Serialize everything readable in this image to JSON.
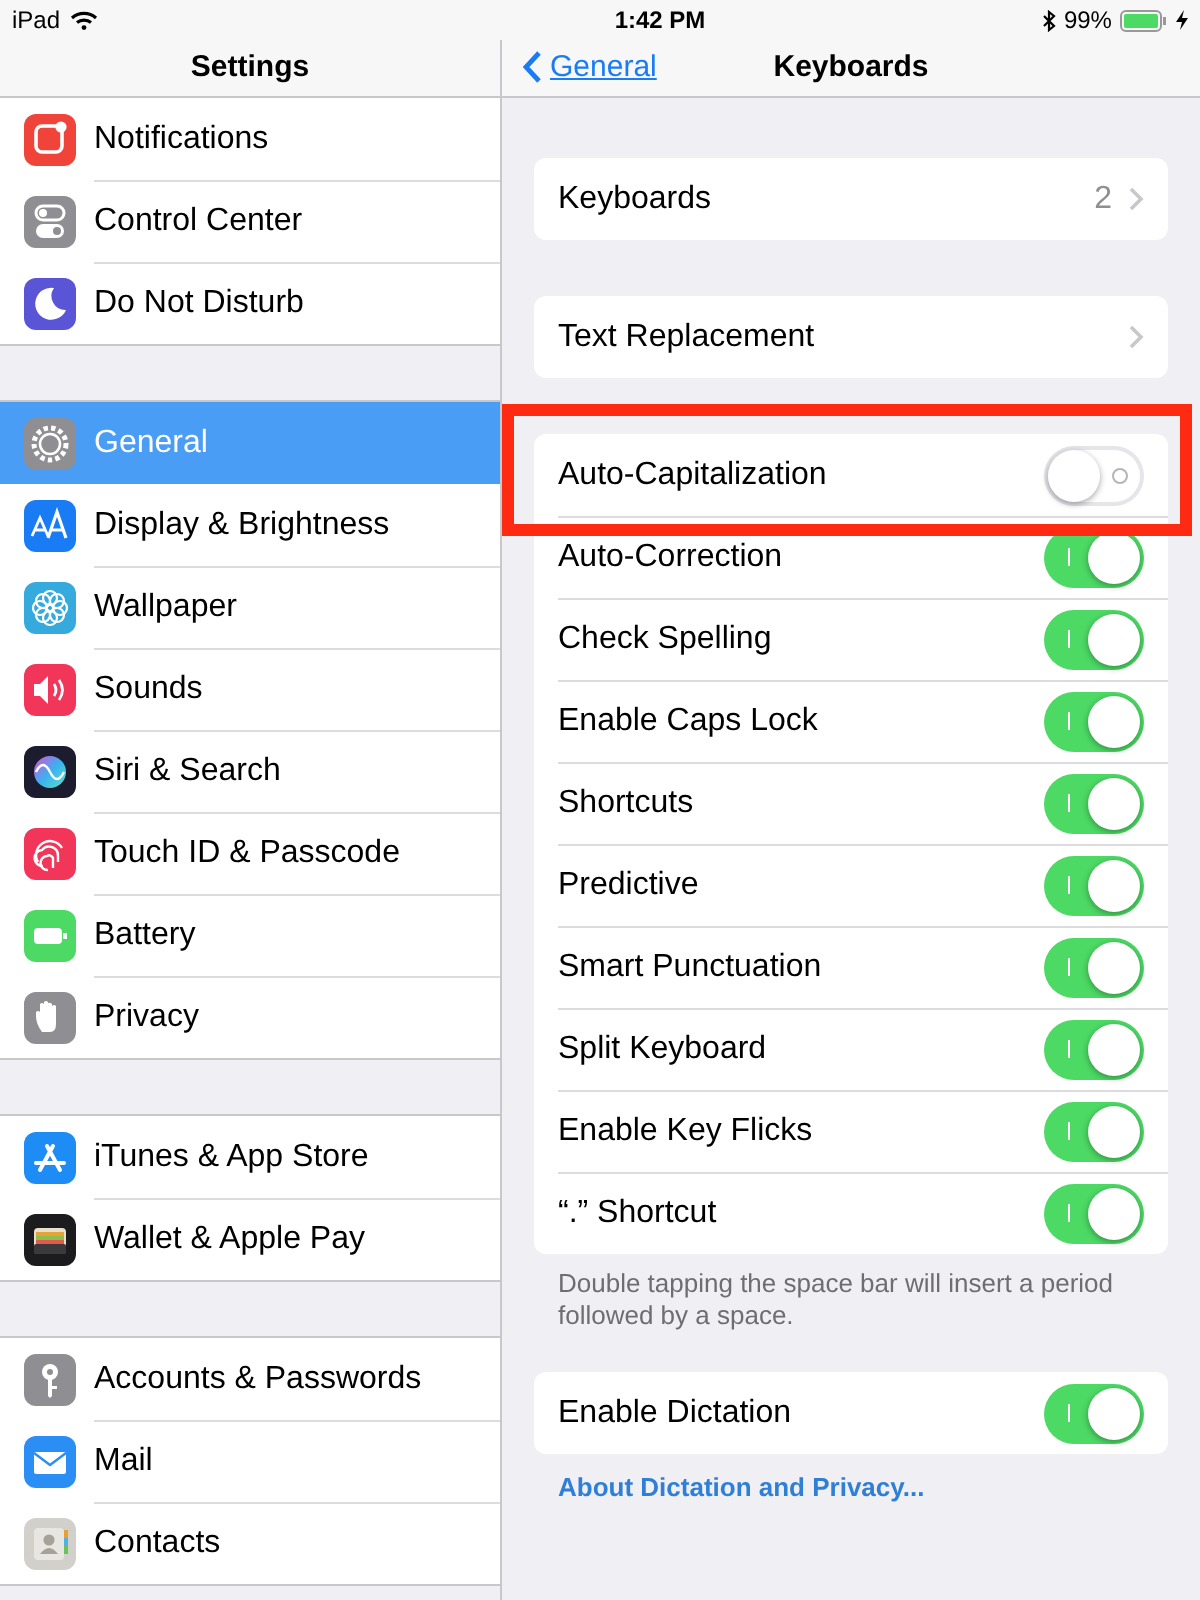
{
  "status_bar": {
    "device": "iPad",
    "time": "1:42 PM",
    "battery": "99%",
    "charging": true
  },
  "sidebar": {
    "title": "Settings",
    "groups": [
      {
        "items": [
          {
            "label": "Notifications",
            "color": "#f0443a",
            "selected": false
          },
          {
            "label": "Control Center",
            "color": "#8e8e93",
            "selected": false
          },
          {
            "label": "Do Not Disturb",
            "color": "#5a55d6",
            "selected": false
          }
        ]
      },
      {
        "items": [
          {
            "label": "General",
            "color": "#8e8e93",
            "selected": true
          },
          {
            "label": "Display & Brightness",
            "color": "#1a7cf5",
            "selected": false
          },
          {
            "label": "Wallpaper",
            "color": "#36aadc",
            "selected": false
          },
          {
            "label": "Sounds",
            "color": "#f1365a",
            "selected": false
          },
          {
            "label": "Siri & Search",
            "color": "#1c1c2e",
            "selected": false
          },
          {
            "label": "Touch ID & Passcode",
            "color": "#f1365a",
            "selected": false
          },
          {
            "label": "Battery",
            "color": "#4cd964",
            "selected": false
          },
          {
            "label": "Privacy",
            "color": "#8e8e93",
            "selected": false
          }
        ]
      },
      {
        "items": [
          {
            "label": "iTunes & App Store",
            "color": "#1e8cf5",
            "selected": false
          },
          {
            "label": "Wallet & Apple Pay",
            "color": "#1c1c1e",
            "selected": false
          }
        ]
      },
      {
        "items": [
          {
            "label": "Accounts & Passwords",
            "color": "#8e8e93",
            "selected": false
          },
          {
            "label": "Mail",
            "color": "#2a8ef5",
            "selected": false
          },
          {
            "label": "Contacts",
            "color": "#d2d0cb",
            "selected": false
          }
        ]
      }
    ]
  },
  "detail": {
    "back": "General",
    "title": "Keyboards",
    "groups": [
      {
        "rows": [
          {
            "kind": "link",
            "label": "Keyboards",
            "value": "2"
          }
        ]
      },
      {
        "rows": [
          {
            "kind": "link",
            "label": "Text Replacement"
          }
        ]
      },
      {
        "rows": [
          {
            "kind": "toggle",
            "label": "Auto-Capitalization",
            "on": false,
            "highlighted": true
          },
          {
            "kind": "toggle",
            "label": "Auto-Correction",
            "on": true,
            "highlighted": false
          },
          {
            "kind": "toggle",
            "label": "Check Spelling",
            "on": true,
            "highlighted": false
          },
          {
            "kind": "toggle",
            "label": "Enable Caps Lock",
            "on": true,
            "highlighted": false
          },
          {
            "kind": "toggle",
            "label": "Shortcuts",
            "on": true,
            "highlighted": false
          },
          {
            "kind": "toggle",
            "label": "Predictive",
            "on": true,
            "highlighted": false
          },
          {
            "kind": "toggle",
            "label": "Smart Punctuation",
            "on": true,
            "highlighted": false
          },
          {
            "kind": "toggle",
            "label": "Split Keyboard",
            "on": true,
            "highlighted": false
          },
          {
            "kind": "toggle",
            "label": "Enable Key Flicks",
            "on": true,
            "highlighted": false
          },
          {
            "kind": "toggle",
            "label": "“.” Shortcut",
            "on": true,
            "highlighted": false
          }
        ],
        "footer": {
          "kind": "note",
          "text": "Double tapping the space bar will insert a period followed by a space."
        }
      },
      {
        "rows": [
          {
            "kind": "toggle",
            "label": "Enable Dictation",
            "on": true,
            "highlighted": false
          }
        ],
        "footer": {
          "kind": "link",
          "text": "About Dictation and Privacy..."
        }
      }
    ]
  }
}
